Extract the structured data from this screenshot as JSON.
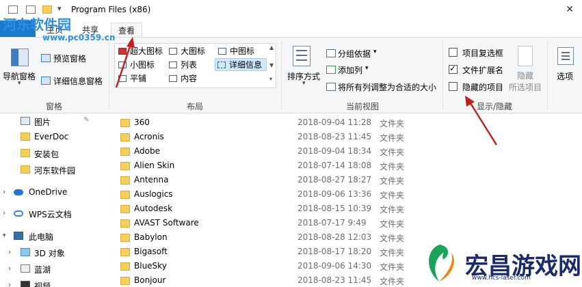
{
  "window": {
    "title": "Program Files (x86)",
    "close_glyph": "✕"
  },
  "tabs": [
    {
      "label": "文件"
    },
    {
      "label": "主页"
    },
    {
      "label": "共享"
    },
    {
      "label": "查看"
    }
  ],
  "watermark": {
    "logo": "河东软件园",
    "url": "www.pc0359.cn",
    "brand": "宏昌游戏网",
    "brand_url": "www.hcs-laser.com"
  },
  "ribbon": {
    "pane": {
      "nav_pane": "导航窗格",
      "preview": "预览窗格",
      "details": "详细信息窗格",
      "group": "窗格"
    },
    "layout": {
      "items": [
        "超大图标",
        "大图标",
        "中图标",
        "小图标",
        "列表",
        "详细信息",
        "平铺",
        "内容"
      ],
      "selected": "详细信息",
      "group": "布局"
    },
    "current_view": {
      "sort": "排序方式",
      "group_by": "分组依据",
      "add_columns": "添加列",
      "fit_columns": "将所有列调整为合适的大小",
      "group": "当前视图"
    },
    "show_hide": {
      "item_checkboxes": "项目复选框",
      "file_extensions": "文件扩展名",
      "hidden_items": "隐藏的项目",
      "item_checkboxes_checked": false,
      "file_extensions_checked": true,
      "hidden_items_checked": false,
      "hide": "隐藏",
      "hide_selected": "所选项目",
      "group": "显示/隐藏"
    },
    "options": "选项"
  },
  "nav": {
    "items": [
      {
        "label": "图片",
        "pinned": true
      },
      {
        "label": "EverDoc"
      },
      {
        "label": "安装包"
      },
      {
        "label": "河东软件园"
      },
      {
        "label": "OneDrive"
      },
      {
        "label": "WPS云文档"
      },
      {
        "label": "此电脑"
      },
      {
        "label": "3D 对象"
      },
      {
        "label": "蓝湖"
      },
      {
        "label": "视频"
      }
    ],
    "colors": {
      "onedrive": "#1e78d2",
      "wps": "#3b7fd8",
      "pc": "#3a6ea5"
    }
  },
  "files": [
    {
      "name": "360",
      "date": "2018-09-04 11:28",
      "type": "文件夹"
    },
    {
      "name": "Acronis",
      "date": "2018-08-23 11:45",
      "type": "文件夹"
    },
    {
      "name": "Adobe",
      "date": "2018-09-04 18:34",
      "type": "文件夹"
    },
    {
      "name": "Alien Skin",
      "date": "2018-07-14 18:08",
      "type": "文件夹"
    },
    {
      "name": "Antenna",
      "date": "2018-08-27 18:27",
      "type": "文件夹"
    },
    {
      "name": "Auslogics",
      "date": "2018-09-06 13:36",
      "type": "文件夹"
    },
    {
      "name": "Autodesk",
      "date": "2018-08-15 10:39",
      "type": "文件夹"
    },
    {
      "name": "AVAST Software",
      "date": "2018-07-17 9:49",
      "type": "文件夹"
    },
    {
      "name": "Babylon",
      "date": "2018-08-28 12:03",
      "type": "文件夹"
    },
    {
      "name": "Bigasoft",
      "date": "2018-08-17 18:20",
      "type": "文件夹"
    },
    {
      "name": "BlueSky",
      "date": "2018-09-06 14:30",
      "type": "文件夹"
    },
    {
      "name": "Bonjour",
      "date": "2018-08-23 11:45",
      "type": "文件夹"
    }
  ],
  "arrow_color": "#c0211f"
}
